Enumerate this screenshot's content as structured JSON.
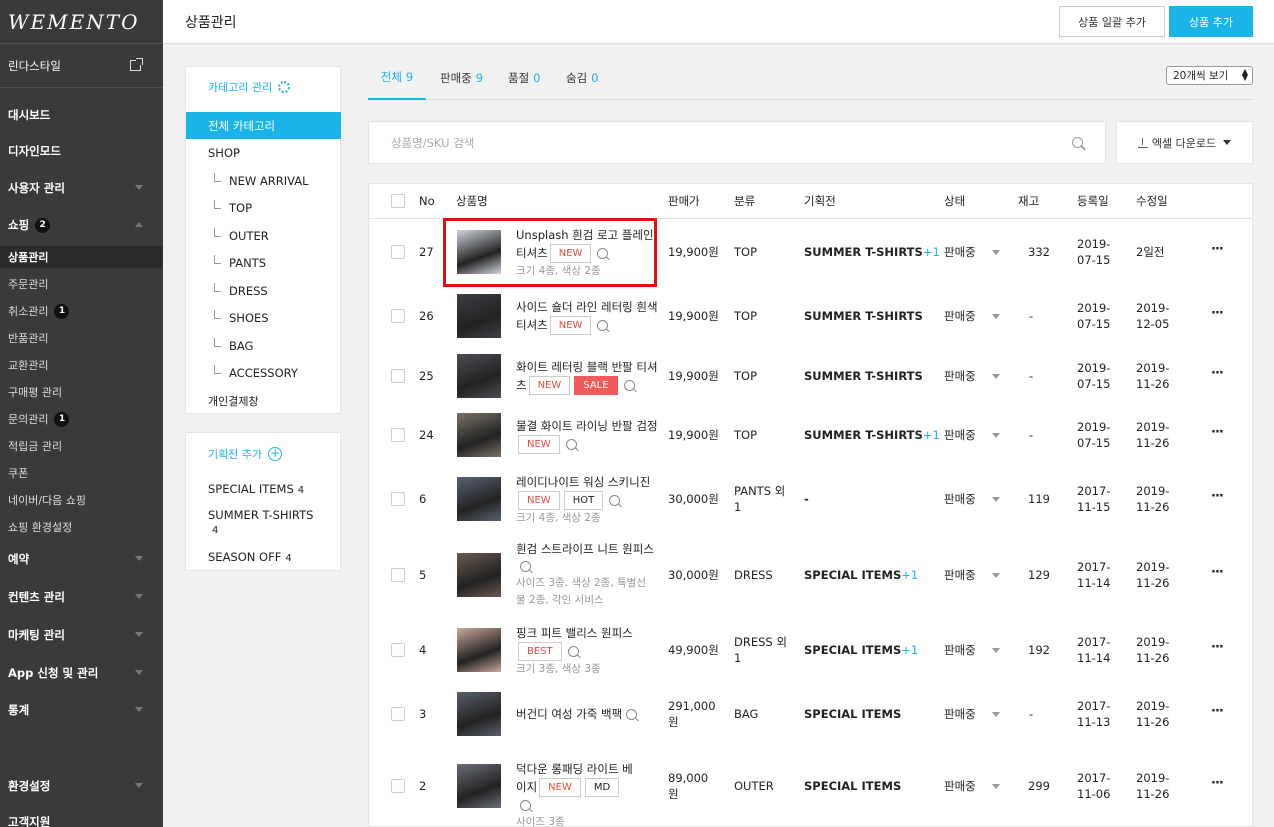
{
  "brand": "WEMENTO",
  "store": {
    "name": "린다스타일"
  },
  "sidebar": {
    "menus": [
      {
        "label": "대시보드"
      },
      {
        "label": "디자인모드"
      },
      {
        "label": "사용자 관리"
      },
      {
        "label": "쇼핑",
        "badge": "2"
      },
      {
        "label": "예약"
      },
      {
        "label": "컨텐츠 관리"
      },
      {
        "label": "마케팅 관리"
      },
      {
        "label": "App 신청 및 관리"
      },
      {
        "label": "통계"
      },
      {
        "label": "환경설정"
      },
      {
        "label": "고객지원"
      }
    ],
    "shop_sub": [
      {
        "label": "상품관리"
      },
      {
        "label": "주문관리"
      },
      {
        "label": "취소관리",
        "badge": "1"
      },
      {
        "label": "반품관리"
      },
      {
        "label": "교환관리"
      },
      {
        "label": "구매평 관리"
      },
      {
        "label": "문의관리",
        "badge": "1"
      },
      {
        "label": "적립금 관리"
      },
      {
        "label": "쿠폰"
      },
      {
        "label": "네이버/다음 쇼핑"
      },
      {
        "label": "쇼핑 환경설정"
      }
    ]
  },
  "header": {
    "title": "상품관리",
    "bulk_add_label": "상품 일괄 추가",
    "add_label": "상품 추가"
  },
  "categories": {
    "title": "카테고리 관리",
    "items": [
      {
        "label": "전체 카테고리"
      },
      {
        "label": "SHOP"
      },
      {
        "label": "NEW ARRIVAL"
      },
      {
        "label": "TOP"
      },
      {
        "label": "OUTER"
      },
      {
        "label": "PANTS"
      },
      {
        "label": "DRESS"
      },
      {
        "label": "SHOES"
      },
      {
        "label": "BAG"
      },
      {
        "label": "ACCESSORY"
      },
      {
        "label": "개인결제창"
      }
    ]
  },
  "plans": {
    "title": "기획전 추가",
    "items": [
      {
        "label": "SPECIAL ITEMS",
        "count": "4"
      },
      {
        "label": "SUMMER T-SHIRTS",
        "count": "4"
      },
      {
        "label": "SEASON OFF",
        "count": "4"
      }
    ]
  },
  "tabs": [
    {
      "label": "전체",
      "count": "9"
    },
    {
      "label": "판매중",
      "count": "9"
    },
    {
      "label": "품절",
      "count": "0"
    },
    {
      "label": "숨김",
      "count": "0"
    }
  ],
  "page_size": "20개씩 보기",
  "search": {
    "placeholder": "상품명/SKU 검색"
  },
  "excel_label": "엑셀 다운로드",
  "table": {
    "headers": {
      "no": "No",
      "name": "상품명",
      "price": "판매가",
      "category": "분류",
      "plan": "기획전",
      "status": "상태",
      "stock": "재고",
      "registered": "등록일",
      "modified": "수정일"
    },
    "rows": [
      {
        "no": "27",
        "name_a": "Unsplash 흰검 로고 플레인",
        "name_b": "티셔츠",
        "tags": [
          "NEW"
        ],
        "meta": "크기 4종, 색상 2종",
        "price": "19,900원",
        "category": "TOP",
        "plan": "SUMMER T-SHIRTS",
        "plan_plus": "+1",
        "status": "판매중",
        "stock": "332",
        "registered": "2019-\n07-15",
        "modified": "2일전"
      },
      {
        "no": "26",
        "name_a": "사이드 숄더 라인 레터링 흰색",
        "name_b": "티셔츠",
        "tags": [
          "NEW"
        ],
        "meta": "",
        "price": "19,900원",
        "category": "TOP",
        "plan": "SUMMER T-SHIRTS",
        "plan_plus": "",
        "status": "판매중",
        "stock": "-",
        "registered": "2019-\n07-15",
        "modified": "2019-\n12-05"
      },
      {
        "no": "25",
        "name_a": "화이트 레터링 블랙 반팔 티셔",
        "name_b": "츠",
        "tags": [
          "NEW",
          "SALE"
        ],
        "meta": "",
        "price": "19,900원",
        "category": "TOP",
        "plan": "SUMMER T-SHIRTS",
        "plan_plus": "",
        "status": "판매중",
        "stock": "-",
        "registered": "2019-\n07-15",
        "modified": "2019-\n11-26"
      },
      {
        "no": "24",
        "name_a": "물결 화이트 라이닝 반팔 검정",
        "name_b": "",
        "tags": [
          "NEW"
        ],
        "meta": "",
        "price": "19,900원",
        "category": "TOP",
        "plan": "SUMMER T-SHIRTS",
        "plan_plus": "+1",
        "status": "판매중",
        "stock": "-",
        "registered": "2019-\n07-15",
        "modified": "2019-\n11-26"
      },
      {
        "no": "6",
        "name_a": "레이디나이트 워싱 스키니진",
        "name_b": "",
        "tags": [
          "NEW",
          "HOT"
        ],
        "meta": "크기 4종, 색상 2종",
        "price": "30,000원",
        "category": "PANTS 외\n1",
        "plan": "-",
        "plan_plus": "",
        "status": "판매중",
        "stock": "119",
        "registered": "2017-\n11-15",
        "modified": "2019-\n11-26"
      },
      {
        "no": "5",
        "name_a": "흰검 스트라이프 니트 원피스",
        "name_b": "",
        "tags": [],
        "meta": "사이즈 3종, 색상 2종, 특별선\n물 2종, 각인 서비스",
        "price": "30,000원",
        "category": "DRESS",
        "plan": "SPECIAL ITEMS",
        "plan_plus": "+1",
        "status": "판매중",
        "stock": "129",
        "registered": "2017-\n11-14",
        "modified": "2019-\n11-26"
      },
      {
        "no": "4",
        "name_a": "핑크 피트 밸리스 원피스",
        "name_b": "",
        "tags": [
          "BEST"
        ],
        "meta": "크기 3종, 색상 3종",
        "price": "49,900원",
        "category": "DRESS 외\n1",
        "plan": "SPECIAL ITEMS",
        "plan_plus": "+1",
        "status": "판매중",
        "stock": "192",
        "registered": "2017-\n11-14",
        "modified": "2019-\n11-26"
      },
      {
        "no": "3",
        "name_a": "버건디 여성 가죽 백팩",
        "name_b": "",
        "tags": [],
        "meta": "",
        "price": "291,000\n원",
        "category": "BAG",
        "plan": "SPECIAL ITEMS",
        "plan_plus": "",
        "status": "판매중",
        "stock": "-",
        "registered": "2017-\n11-13",
        "modified": "2019-\n11-26"
      },
      {
        "no": "2",
        "name_a": "덕다운 롱패딩 라이트 베",
        "name_b": "이지",
        "tags": [
          "NEW",
          "MD"
        ],
        "meta": "사이즈 3종",
        "price": "89,000\n원",
        "category": "OUTER",
        "plan": "SPECIAL ITEMS",
        "plan_plus": "",
        "status": "판매중",
        "stock": "299",
        "registered": "2017-\n11-06",
        "modified": "2019-\n11-26"
      }
    ]
  },
  "colors": {
    "accent": "#1ab4e8",
    "sidebar": "#3a3a3a",
    "tag_red": "#e74c3c",
    "sale": "#f05a5a",
    "highlight": "#e01010"
  }
}
